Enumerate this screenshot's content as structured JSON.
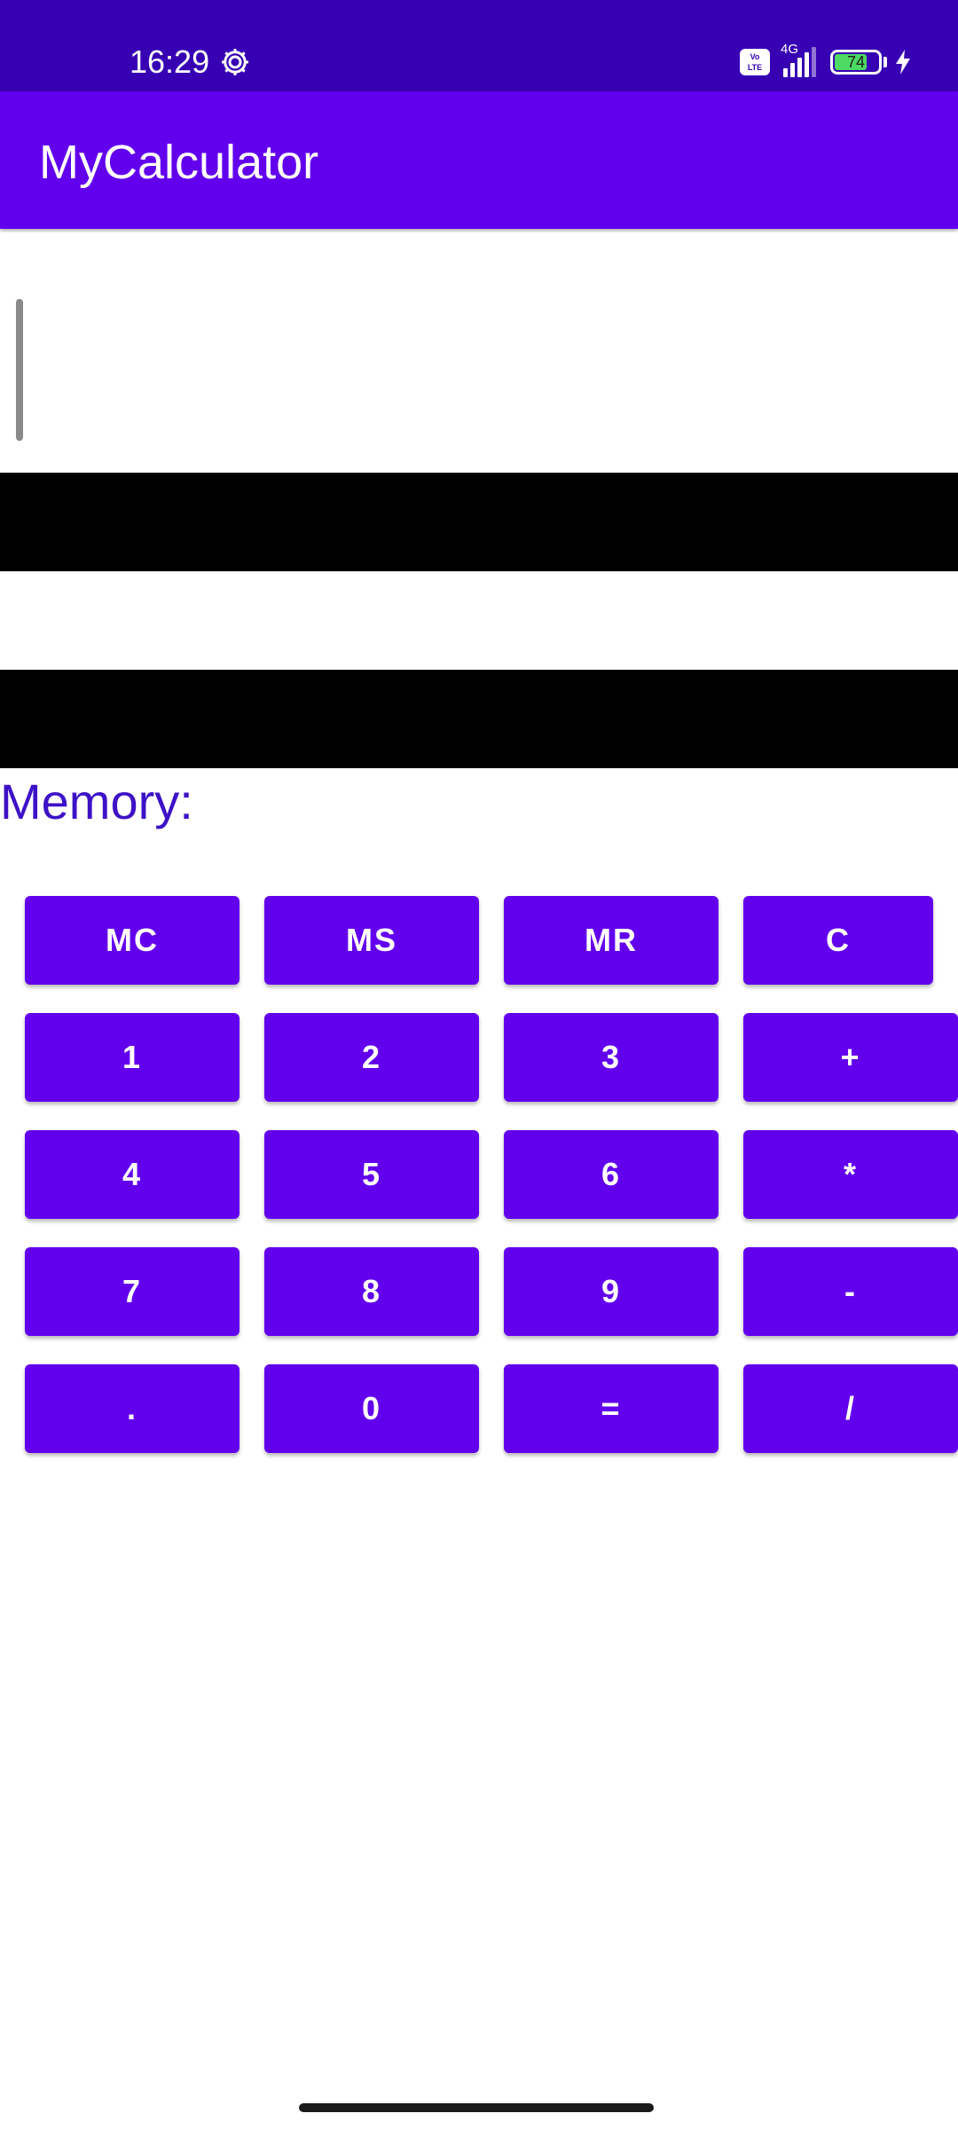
{
  "status_bar": {
    "time": "16:29",
    "volte_line1": "Vo",
    "volte_line2": "LTE",
    "network": "4G",
    "battery_level": "74",
    "icons": [
      "gear-icon",
      "volte-icon",
      "signal-icon",
      "battery-icon",
      "charging-bolt-icon"
    ]
  },
  "app_bar": {
    "title": "MyCalculator"
  },
  "input": {
    "value": ""
  },
  "display": {
    "result_top": "",
    "result_bottom": ""
  },
  "memory": {
    "label": "Memory:"
  },
  "keypad": {
    "rows": [
      [
        "MC",
        "MS",
        "MR",
        "C"
      ],
      [
        "1",
        "2",
        "3",
        "+"
      ],
      [
        "4",
        "5",
        "6",
        "*"
      ],
      [
        "7",
        "8",
        "9",
        "-"
      ],
      [
        ".",
        "0",
        "=",
        "/"
      ]
    ]
  },
  "colors": {
    "status_bar": "#3700b3",
    "app_bar": "#6200ee",
    "button": "#6200ee",
    "memory_text": "#3d12c7",
    "display_band": "#000000"
  }
}
